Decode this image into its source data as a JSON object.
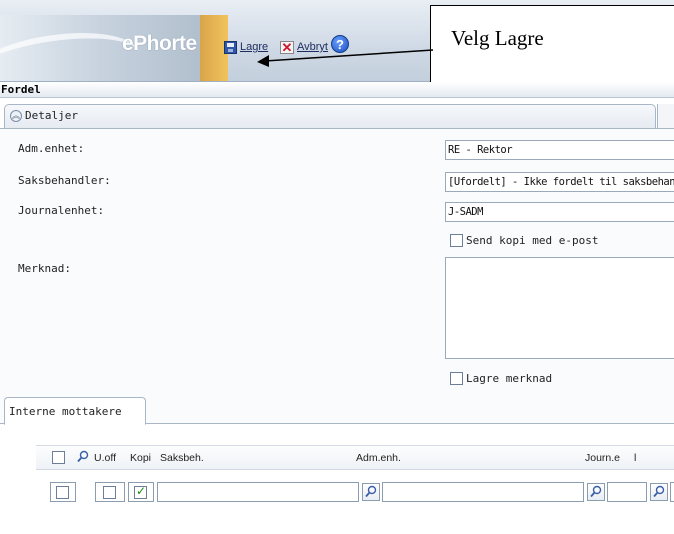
{
  "toolbar": {
    "logo": "ePhorte",
    "save_label": "Lagre",
    "cancel_label": "Avbryt",
    "help_symbol": "?",
    "icons": {
      "save": "save-icon",
      "cancel": "cancel-icon",
      "help": "help-icon"
    }
  },
  "callout": {
    "text": "Velg Lagre"
  },
  "section": {
    "title": "Fordel"
  },
  "panel": {
    "tab_label": "Detaljer",
    "fields": {
      "adm_label": "Adm.enhet:",
      "adm_value": "RE - Rektor",
      "saksbeh_label": "Saksbehandler:",
      "saksbeh_value": "[Ufordelt] - Ikke fordelt til saksbehandle",
      "journal_label": "Journalenhet:",
      "journal_value": "J-SADM",
      "send_kopi_label": "Send kopi med e-post",
      "merknad_label": "Merknad:",
      "lagre_merknad_label": "Lagre merknad"
    }
  },
  "recipients": {
    "tab_label": "Interne mottakere",
    "columns": {
      "uoff": "U.off",
      "kopi": "Kopi",
      "saksbeh": "Saksbeh.",
      "admenh": "Adm.enh.",
      "journ": "Journ.e",
      "more": "l"
    },
    "row": {
      "select": false,
      "uoff": false,
      "kopi": true
    }
  },
  "colors": {
    "accent": "#2f56a8",
    "cancel": "#d0142c",
    "check": "#1a8a1a"
  }
}
